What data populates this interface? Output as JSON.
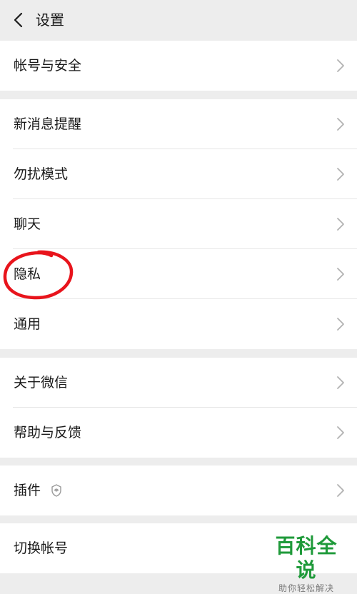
{
  "header": {
    "title": "设置",
    "back_icon": "chevron-left-icon"
  },
  "groups": [
    {
      "items": [
        {
          "label": "帐号与安全"
        }
      ]
    },
    {
      "items": [
        {
          "label": "新消息提醒"
        },
        {
          "label": "勿扰模式"
        },
        {
          "label": "聊天"
        },
        {
          "label": "隐私"
        },
        {
          "label": "通用"
        }
      ]
    },
    {
      "items": [
        {
          "label": "关于微信"
        },
        {
          "label": "帮助与反馈"
        }
      ]
    },
    {
      "items": [
        {
          "label": "插件",
          "icon": "plugin-shield-icon"
        }
      ]
    },
    {
      "items": [
        {
          "label": "切换帐号"
        }
      ]
    }
  ],
  "annotation": {
    "highlight_color": "#e8141c",
    "highlighted_item": "隐私"
  },
  "watermark": {
    "main": "百科全说",
    "sub": "助你轻松解决",
    "color": "#1f9a3a"
  }
}
